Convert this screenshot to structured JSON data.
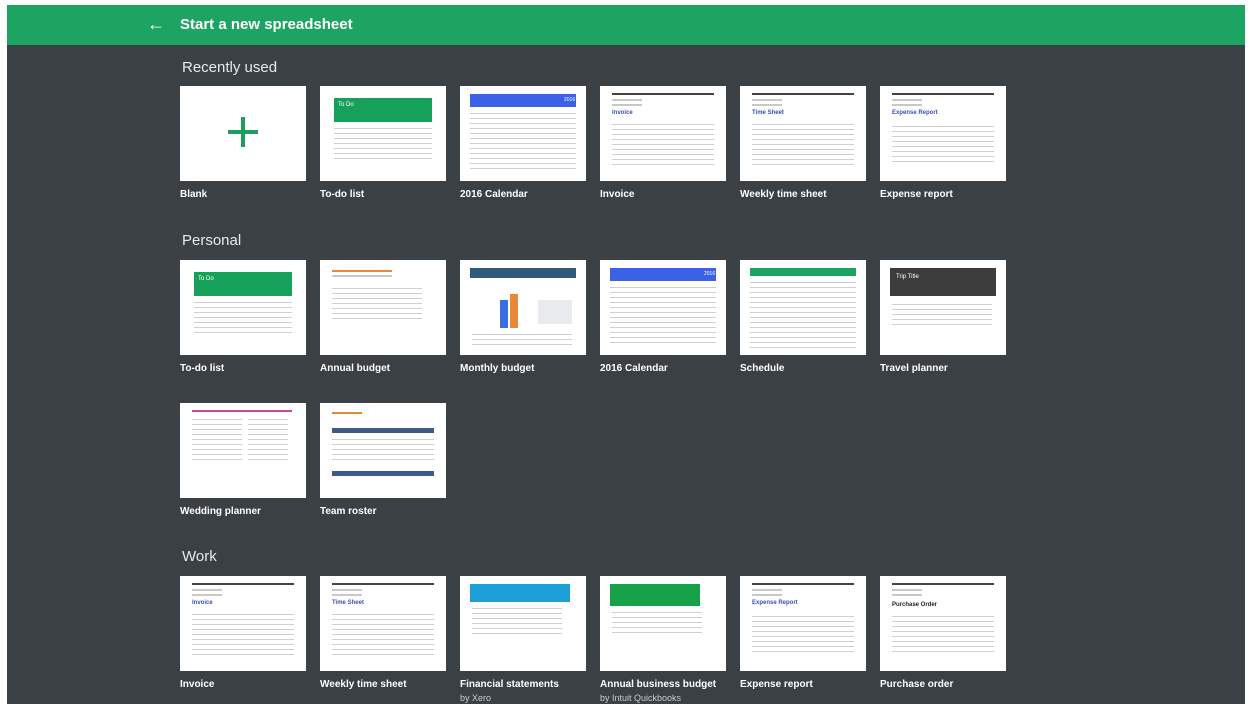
{
  "header": {
    "back_label": "←",
    "title": "Start a new spreadsheet"
  },
  "colors": {
    "header": "#1da462",
    "background": "#3b4044",
    "accent_green": "#16a05a",
    "calendar_blue": "#3b62e6"
  },
  "sections": [
    {
      "title": "Recently used",
      "templates": [
        {
          "name": "Blank",
          "thumb": "blank"
        },
        {
          "name": "To-do list",
          "thumb": "todo"
        },
        {
          "name": "2016 Calendar",
          "thumb": "calendar"
        },
        {
          "name": "Invoice",
          "thumb": "invoice"
        },
        {
          "name": "Weekly time sheet",
          "thumb": "timesheet"
        },
        {
          "name": "Expense report",
          "thumb": "expense"
        }
      ]
    },
    {
      "title": "Personal",
      "templates": [
        {
          "name": "To-do list",
          "thumb": "todo"
        },
        {
          "name": "Annual budget",
          "thumb": "budget"
        },
        {
          "name": "Monthly budget",
          "thumb": "monthly"
        },
        {
          "name": "2016 Calendar",
          "thumb": "calendar"
        },
        {
          "name": "Schedule",
          "thumb": "schedule"
        },
        {
          "name": "Travel planner",
          "thumb": "travel"
        },
        {
          "name": "Wedding planner",
          "thumb": "wedding"
        },
        {
          "name": "Team roster",
          "thumb": "roster"
        }
      ]
    },
    {
      "title": "Work",
      "templates": [
        {
          "name": "Invoice",
          "thumb": "invoice"
        },
        {
          "name": "Weekly time sheet",
          "thumb": "timesheet"
        },
        {
          "name": "Financial statements",
          "thumb": "financial",
          "by": "by Xero"
        },
        {
          "name": "Annual business budget",
          "thumb": "business",
          "by": "by Intuit Quickbooks"
        },
        {
          "name": "Expense report",
          "thumb": "expense"
        },
        {
          "name": "Purchase order",
          "thumb": "purchase"
        }
      ]
    }
  ],
  "thumb_text": {
    "todo_title": "To Do",
    "invoice_title": "Invoice",
    "timesheet_title": "Time Sheet",
    "expense_title": "Expense Report",
    "purchase_title": "Purchase Order",
    "travel_title": "Trip Title",
    "calendar_year": "2016"
  }
}
